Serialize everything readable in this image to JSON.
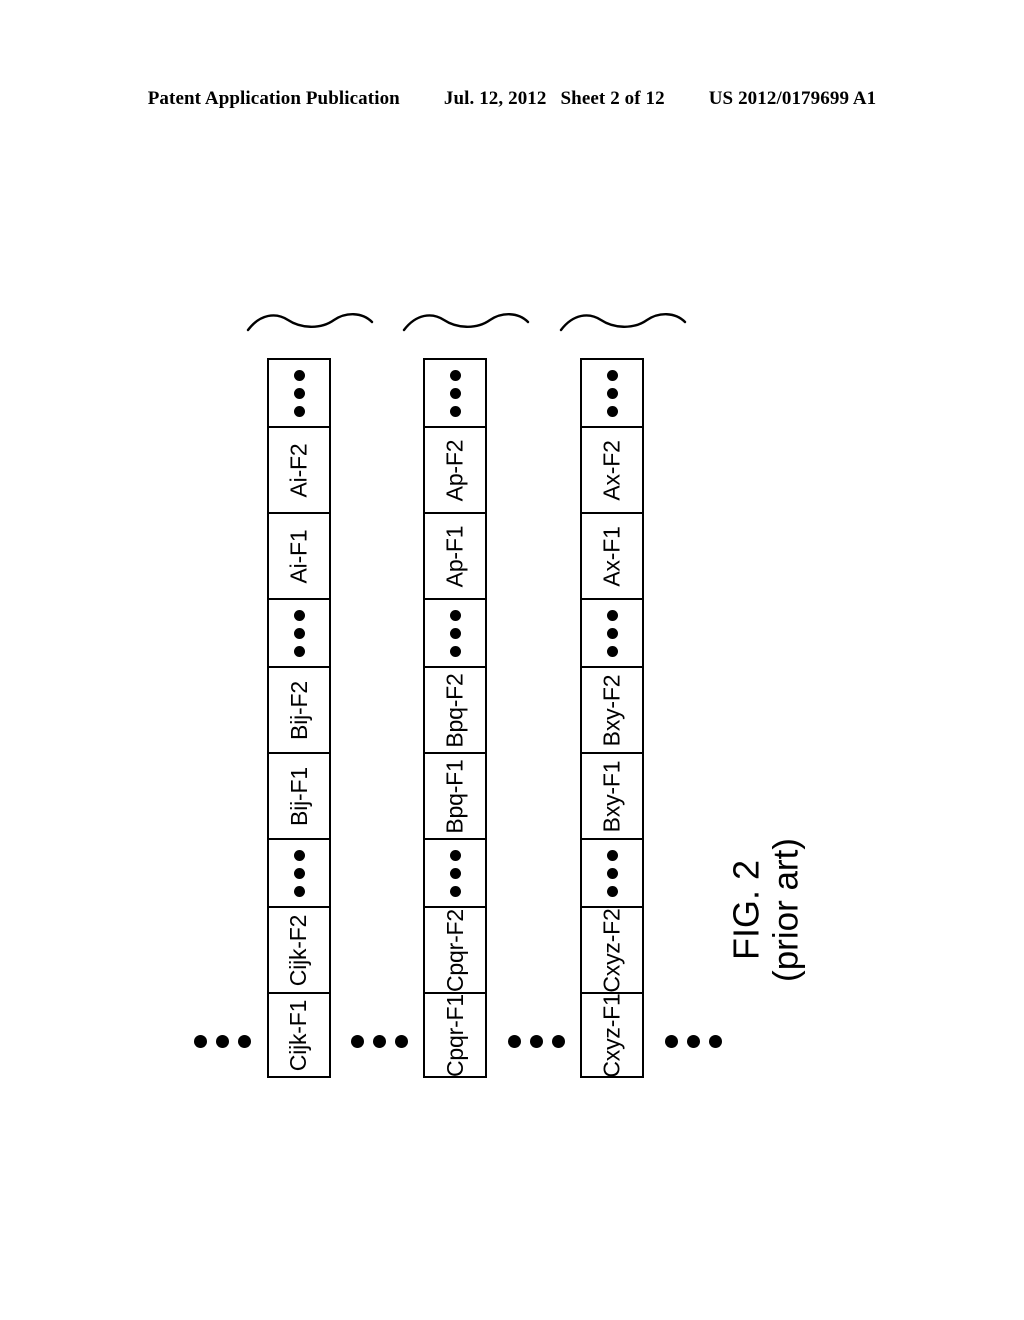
{
  "header": {
    "publication": "Patent Application Publication",
    "date": "Jul. 12, 2012",
    "sheet": "Sheet 2 of 12",
    "patent_number": "US 2012/0179699 A1"
  },
  "figure": {
    "caption_line1": "FIG. 2",
    "caption_line2": "(prior art)",
    "ellipsis_glyph": "•••",
    "columns": [
      {
        "name": "column-1",
        "cells": [
          {
            "type": "label",
            "text": "Cijk-F1"
          },
          {
            "type": "label",
            "text": "Cijk-F2"
          },
          {
            "type": "dots",
            "text": ""
          },
          {
            "type": "label",
            "text": "Bij-F1"
          },
          {
            "type": "label",
            "text": "Bij-F2"
          },
          {
            "type": "dots",
            "text": ""
          },
          {
            "type": "label",
            "text": "Ai-F1"
          },
          {
            "type": "label",
            "text": "Ai-F2"
          },
          {
            "type": "dots",
            "text": ""
          }
        ]
      },
      {
        "name": "column-2",
        "cells": [
          {
            "type": "label",
            "text": "Cpqr-F1"
          },
          {
            "type": "label",
            "text": "Cpqr-F2"
          },
          {
            "type": "dots",
            "text": ""
          },
          {
            "type": "label",
            "text": "Bpq-F1"
          },
          {
            "type": "label",
            "text": "Bpq-F2"
          },
          {
            "type": "dots",
            "text": ""
          },
          {
            "type": "label",
            "text": "Ap-F1"
          },
          {
            "type": "label",
            "text": "Ap-F2"
          },
          {
            "type": "dots",
            "text": ""
          }
        ]
      },
      {
        "name": "column-3",
        "cells": [
          {
            "type": "label",
            "text": "Cxyz-F1"
          },
          {
            "type": "label",
            "text": "Cxyz-F2"
          },
          {
            "type": "dots",
            "text": ""
          },
          {
            "type": "label",
            "text": "Bxy-F1"
          },
          {
            "type": "label",
            "text": "Bxy-F2"
          },
          {
            "type": "dots",
            "text": ""
          },
          {
            "type": "label",
            "text": "Ax-F1"
          },
          {
            "type": "label",
            "text": "Ax-F2"
          },
          {
            "type": "dots",
            "text": ""
          }
        ]
      }
    ],
    "row_ellipses_count": 4
  },
  "colors": {
    "ink": "#000000",
    "paper": "#ffffff"
  }
}
